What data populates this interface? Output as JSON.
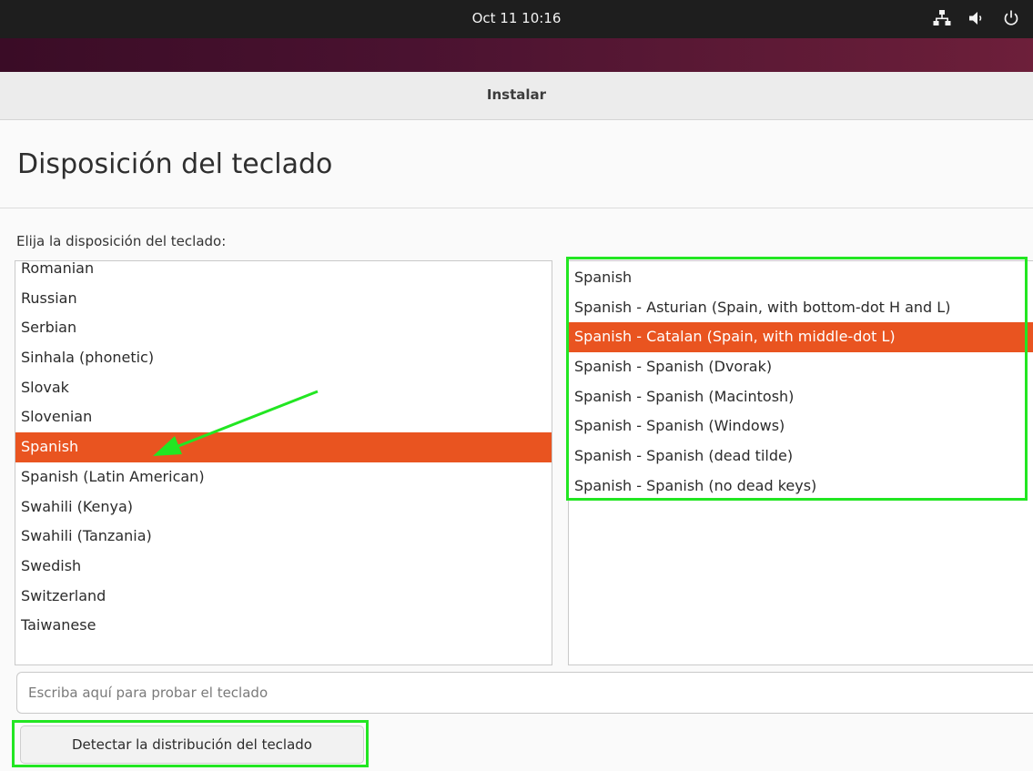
{
  "topbar": {
    "clock": "Oct 11  10:16",
    "icons": [
      "network-icon",
      "volume-icon",
      "power-icon"
    ]
  },
  "window": {
    "title": "Instalar"
  },
  "page": {
    "title": "Disposición del teclado",
    "prompt": "Elija la disposición del teclado:"
  },
  "layouts": {
    "items": [
      "Romanian",
      "Russian",
      "Serbian",
      "Sinhala (phonetic)",
      "Slovak",
      "Slovenian",
      "Spanish",
      "Spanish (Latin American)",
      "Swahili (Kenya)",
      "Swahili (Tanzania)",
      "Swedish",
      "Switzerland",
      "Taiwanese"
    ],
    "selected": "Spanish"
  },
  "variants": {
    "items": [
      "Spanish",
      "Spanish - Asturian (Spain, with bottom-dot H and L)",
      "Spanish - Catalan (Spain, with middle-dot L)",
      "Spanish - Spanish (Dvorak)",
      "Spanish - Spanish (Macintosh)",
      "Spanish - Spanish (Windows)",
      "Spanish - Spanish (dead tilde)",
      "Spanish - Spanish (no dead keys)"
    ],
    "selected": "Spanish - Catalan (Spain, with middle-dot L)"
  },
  "test_input": {
    "placeholder": "Escriba aquí para probar el teclado",
    "value": ""
  },
  "detect_button": {
    "label": "Detectar la distribución del teclado"
  },
  "colors": {
    "accent": "#e95420",
    "highlight": "#22e622",
    "topbar": "#1e1e1e"
  }
}
